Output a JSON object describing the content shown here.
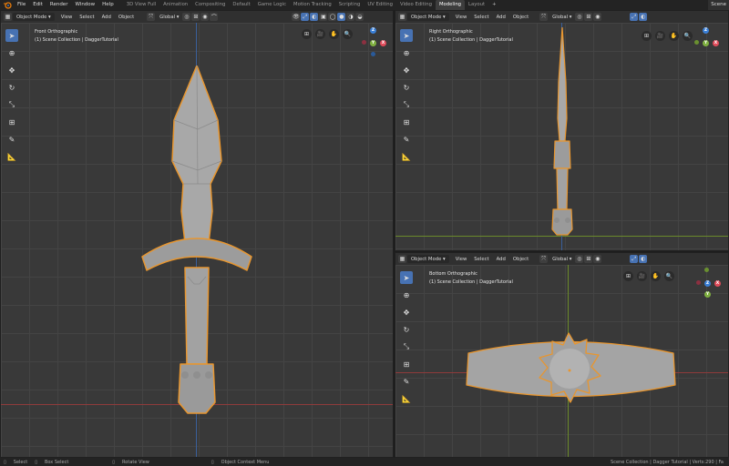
{
  "topbar": {
    "menus": [
      "File",
      "Edit",
      "Render",
      "Window",
      "Help"
    ],
    "workspaces": [
      "3D View Full",
      "Animation",
      "Compositing",
      "Default",
      "Game Logic",
      "Motion Tracking",
      "Scripting",
      "UV Editing",
      "Video Editing",
      "Modeling",
      "Layout"
    ],
    "active_workspace": "Modeling",
    "plus": "+",
    "scene": "Scene"
  },
  "header": {
    "mode": "Object Mode",
    "menus": [
      "View",
      "Select",
      "Add",
      "Object"
    ],
    "transform": "Global"
  },
  "viewports": {
    "front": {
      "view_name": "Front Orthographic",
      "collection": "(1) Scene Collection | DaggerTutorial"
    },
    "right": {
      "view_name": "Right Orthographic",
      "collection": "(1) Scene Collection | DaggerTutorial"
    },
    "bottom": {
      "view_name": "Bottom Orthographic",
      "collection": "(1) Scene Collection | DaggerTutorial"
    }
  },
  "gizmo": {
    "x": "X",
    "y": "Y",
    "z": "Z"
  },
  "statusbar": {
    "select": "Select",
    "box_select": "Box Select",
    "rotate_view": "Rotate View",
    "context_menu": "Object Context Menu",
    "info": "Scene Collection | Dagger Tutorial | Verts:290 | Fa"
  },
  "colors": {
    "accent": "#4772b3",
    "selection_outline": "#e8962f",
    "axis_x": "#e04b5a",
    "axis_y": "#7fb040",
    "axis_z": "#3a7fd6"
  }
}
